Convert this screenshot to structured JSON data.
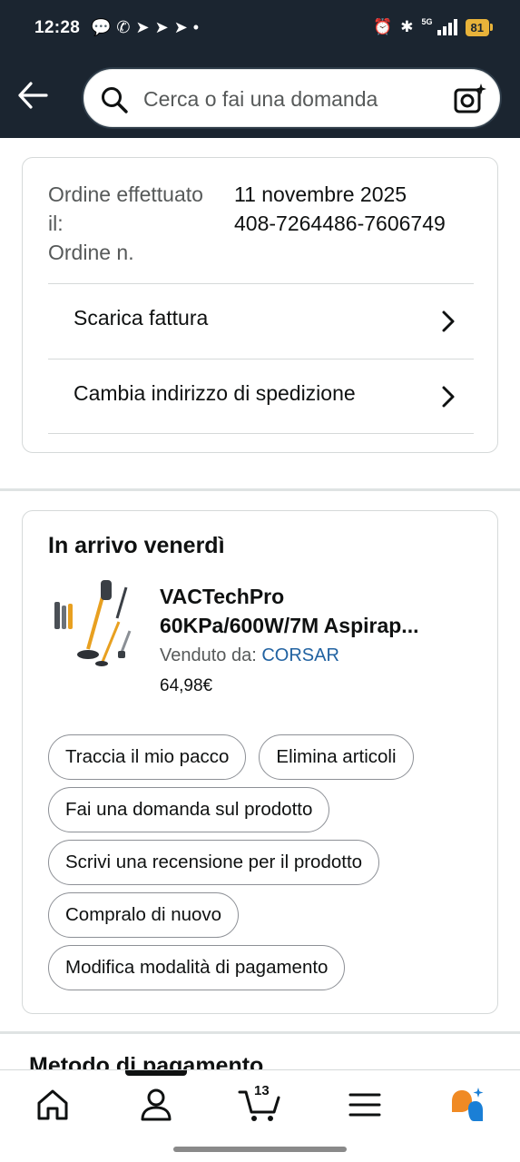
{
  "status_bar": {
    "time": "12:28",
    "notification_icons": [
      "chat-bubble-icon",
      "whatsapp-icon",
      "telegram-icon",
      "telegram-icon",
      "telegram-icon",
      "dot-icon"
    ],
    "network": "5G",
    "battery": "81"
  },
  "header": {
    "search_placeholder": "Cerca o fai una domanda"
  },
  "order": {
    "placed_label": "Ordine effettuato il:",
    "placed_value": "11 novembre 2025",
    "number_label": "Ordine n.",
    "number_value": "408-7264486-7606749",
    "actions": [
      {
        "label": "Scarica fattura"
      },
      {
        "label": "Cambia indirizzo di spedizione"
      }
    ]
  },
  "shipment": {
    "heading": "In arrivo venerdì",
    "product": {
      "title_line1": "VACTechPro",
      "title_line2": "60KPa/600W/7M Aspirap...",
      "sold_by_label": "Venduto da: ",
      "seller": "CORSAR",
      "price": "64,98€"
    },
    "buttons": [
      "Traccia il mio pacco",
      "Elimina articoli",
      "Fai una domanda sul prodotto",
      "Scrivi una recensione per il prodotto",
      "Compralo di nuovo",
      "Modifica modalità di pagamento"
    ]
  },
  "next_section": {
    "heading": "Metodo di pagamento"
  },
  "bottom_nav": {
    "cart_count": "13",
    "items": [
      "home-icon",
      "account-icon",
      "cart-icon",
      "menu-icon",
      "rufus-icon"
    ]
  },
  "colors": {
    "header_bg": "#1b2530",
    "link": "#2162a1",
    "battery": "#e8b33a",
    "rufus_orange": "#f08a24",
    "rufus_blue": "#1a7fd6"
  }
}
